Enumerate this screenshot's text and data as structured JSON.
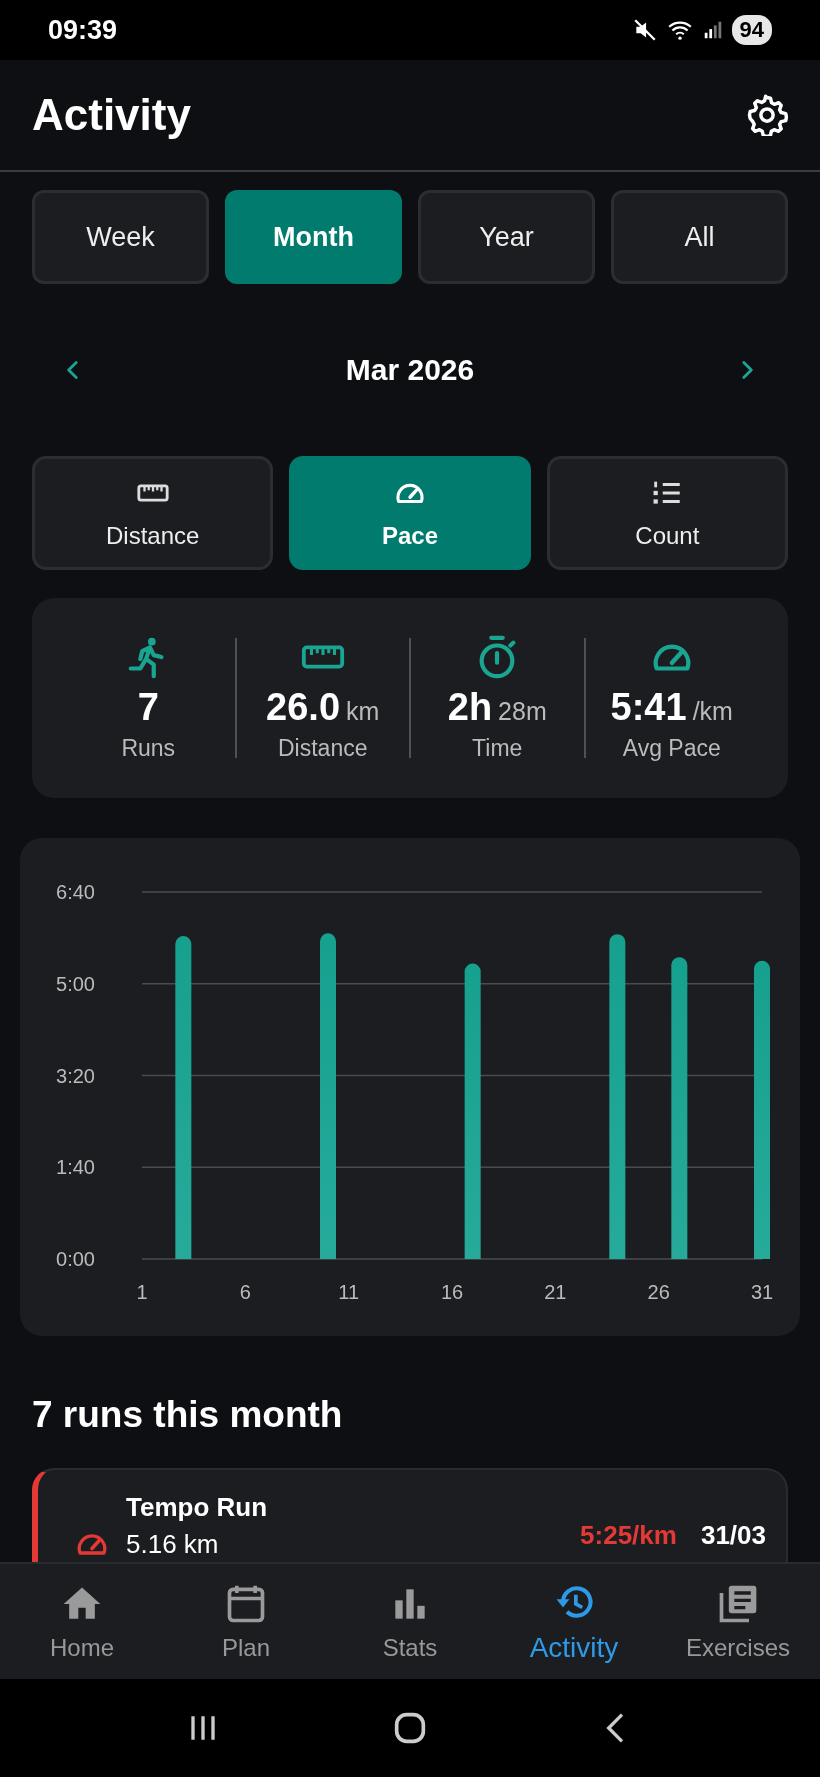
{
  "status_bar": {
    "time": "09:39",
    "battery": "94"
  },
  "header": {
    "title": "Activity"
  },
  "periods": [
    {
      "label": "Week",
      "selected": false
    },
    {
      "label": "Month",
      "selected": true
    },
    {
      "label": "Year",
      "selected": false
    },
    {
      "label": "All",
      "selected": false
    }
  ],
  "month_nav": {
    "label": "Mar 2026"
  },
  "metrics": [
    {
      "kind": "distance",
      "label": "Distance",
      "selected": false
    },
    {
      "kind": "pace",
      "label": "Pace",
      "selected": true
    },
    {
      "kind": "count",
      "label": "Count",
      "selected": false
    }
  ],
  "summary": [
    {
      "kind": "runs",
      "value": "7",
      "label": "Runs"
    },
    {
      "kind": "distance",
      "value": "26.0",
      "unit": "km",
      "label": "Distance"
    },
    {
      "kind": "time",
      "value": "2h",
      "unit": "28m",
      "label": "Time"
    },
    {
      "kind": "pace",
      "value": "5:41",
      "unit": "/km",
      "label": "Avg Pace"
    }
  ],
  "chart": {
    "chart_data": {
      "type": "bar",
      "x": [
        3,
        10,
        17,
        24,
        27,
        31
      ],
      "grid": true,
      "series": [
        {
          "color": "#16a08e",
          "values": [
            352,
            355,
            322,
            354,
            329,
            325
          ]
        }
      ],
      "xlim": [
        1,
        31
      ],
      "ylim": [
        0,
        400
      ],
      "xticks": [
        1,
        6,
        11,
        16,
        21,
        26,
        31
      ],
      "yticks": [
        {
          "value": 0,
          "label": "0:00"
        },
        {
          "value": 100,
          "label": "1:40"
        },
        {
          "value": 200,
          "label": "3:20"
        },
        {
          "value": 300,
          "label": "5:00"
        },
        {
          "value": 400,
          "label": "6:40"
        }
      ]
    }
  },
  "runs_heading": "7 runs this month",
  "runs": [
    {
      "kind": "pace",
      "title": "Tempo Run",
      "distance": "5.16 km",
      "pace": "5:25/km",
      "date": "31/03",
      "color": "#e53935"
    }
  ],
  "bottom_nav": [
    {
      "kind": "home",
      "label": "Home",
      "selected": false
    },
    {
      "kind": "plan",
      "label": "Plan",
      "selected": false
    },
    {
      "kind": "stats",
      "label": "Stats",
      "selected": false
    },
    {
      "kind": "activity",
      "label": "Activity",
      "selected": true
    },
    {
      "kind": "exercises",
      "label": "Exercises",
      "selected": false
    }
  ]
}
